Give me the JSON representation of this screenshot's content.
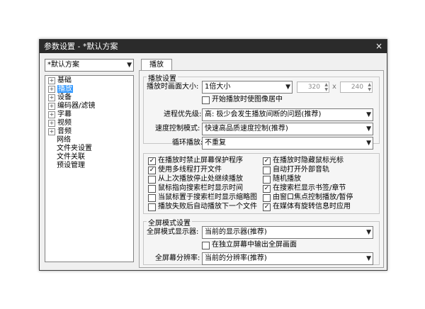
{
  "window": {
    "title": "参数设置 - *默认方案",
    "close_glyph": "×"
  },
  "profile": {
    "selected": "*默认方案"
  },
  "tree": {
    "items": [
      {
        "label": "基础",
        "expander": "+"
      },
      {
        "label": "播放",
        "expander": "+",
        "selected": true
      },
      {
        "label": "设备",
        "expander": "+"
      },
      {
        "label": "编码器/滤镜",
        "expander": "+"
      },
      {
        "label": "字幕",
        "expander": "+"
      },
      {
        "label": "视频",
        "expander": "+"
      },
      {
        "label": "音频",
        "expander": "+"
      },
      {
        "label": "网络",
        "expander": ""
      },
      {
        "label": "文件夹设置",
        "expander": ""
      },
      {
        "label": "文件关联",
        "expander": ""
      },
      {
        "label": "预设管理",
        "expander": ""
      }
    ]
  },
  "tab": {
    "label": "播放"
  },
  "playback": {
    "group_title": "播放设置",
    "size_label": "播放时画面大小:",
    "size_value": "1倍大小",
    "width_value": "320",
    "times": "x",
    "height_value": "240",
    "center_label": "开始播放时使图像居中",
    "priority_label": "进程优先级:",
    "priority_value": "高: 极少会发生播放间断的问题(推荐)",
    "speed_label": "速度控制模式:",
    "speed_value": "快速高品质速度控制(推荐)",
    "loop_label": "循环播放:",
    "loop_value": "不重复"
  },
  "options": {
    "left": [
      {
        "label": "在播放时禁止屏幕保护程序",
        "checked": true
      },
      {
        "label": "使用多线程打开文件",
        "checked": true
      },
      {
        "label": "从上次播放停止处继续播放",
        "checked": false
      },
      {
        "label": "鼠标指向搜索栏时显示时间",
        "checked": false
      },
      {
        "label": "当鼠标置于搜索栏时显示缩略图",
        "checked": false
      },
      {
        "label": "播放失败后自动播放下一个文件",
        "checked": false
      }
    ],
    "right": [
      {
        "label": "在播放时隐藏鼠标光标",
        "checked": true
      },
      {
        "label": "自动打开外部音轨",
        "checked": false
      },
      {
        "label": "随机播放",
        "checked": false
      },
      {
        "label": "在搜索栏显示书签/章节",
        "checked": true
      },
      {
        "label": "由窗口焦点控制播放/暂停",
        "checked": false
      },
      {
        "label": "在媒体有旋转信息时应用",
        "checked": true
      }
    ]
  },
  "fullscreen": {
    "group_title": "全屏模式设置",
    "monitor_label": "全屏模式显示器:",
    "monitor_value": "当前的显示器(推荐)",
    "separate_label": "在独立屏幕中输出全屏画面",
    "resolution_label": "全屏幕分辨率:",
    "resolution_value": "当前的分辨率(推荐)"
  },
  "icons": {
    "dropdown": "chevron-down-icon",
    "check": "check-icon"
  }
}
